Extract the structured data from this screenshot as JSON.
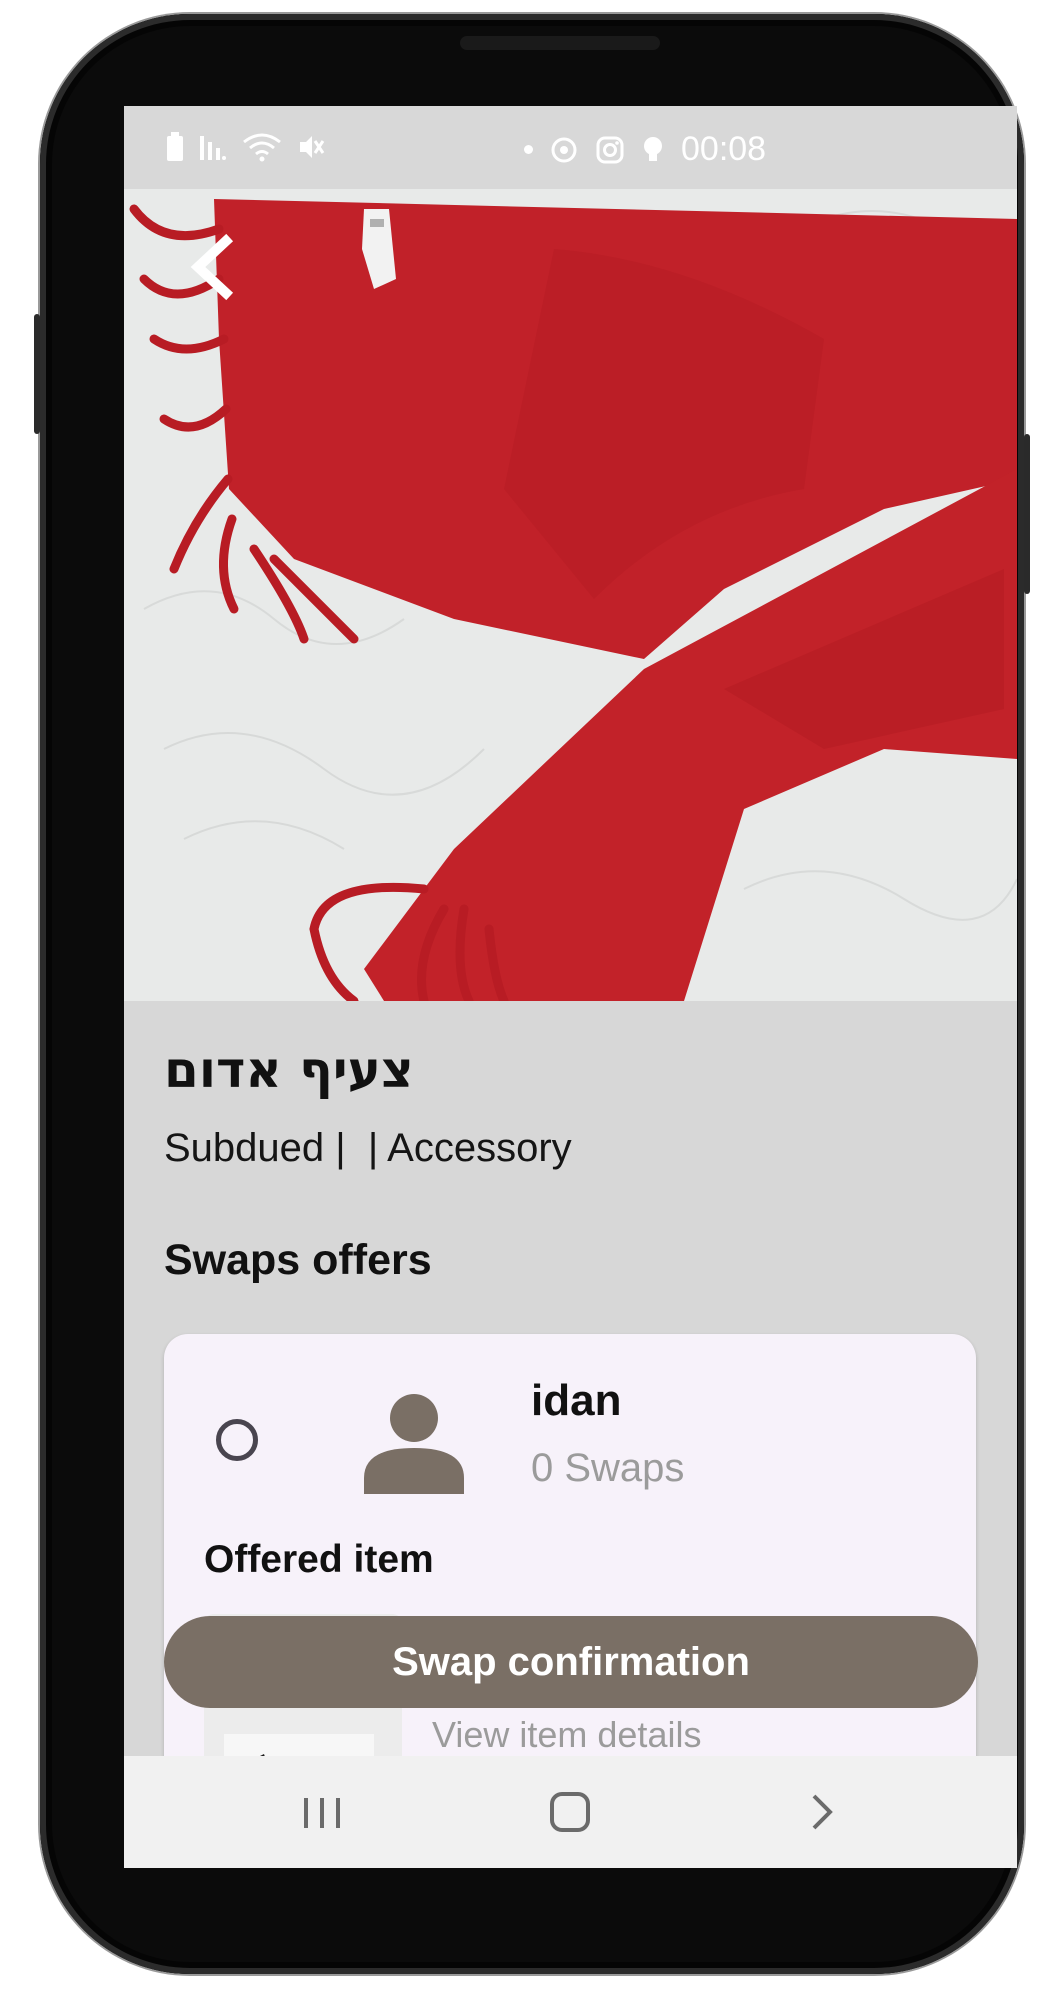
{
  "status_bar": {
    "time": "00:08",
    "icons": [
      "battery-icon",
      "signal-icon",
      "wifi-icon",
      "mute-icon",
      "notification-dot-icon",
      "data-saver-icon",
      "instagram-icon",
      "bulb-icon"
    ]
  },
  "hero": {
    "back_icon": "chevron-left-icon",
    "image_subject": "red-scarf-photo"
  },
  "item": {
    "title": "צעיף אדום",
    "meta": "Subdued |  | Accessory"
  },
  "offers": {
    "section_title": "Swaps offers",
    "cards": [
      {
        "user_name": "idan",
        "swaps_count": "0 Swaps",
        "offered_label": "Offered item",
        "view_details": "View item details"
      }
    ]
  },
  "actions": {
    "confirm_label": "Swap confirmation"
  },
  "nav_bar": {
    "icons": [
      "recent-apps-icon",
      "home-icon",
      "back-nav-icon"
    ]
  },
  "colors": {
    "screen_bg": "#d7d7d7",
    "card_bg": "#f7f2fa",
    "accent": "#7a6f65",
    "muted_text": "#9b9b9b",
    "scarf_red": "#c0202a"
  }
}
